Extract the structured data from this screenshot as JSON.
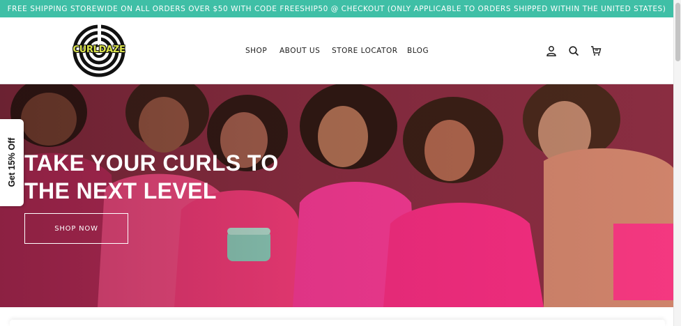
{
  "announcement": {
    "text": "FREE SHIPPING STOREWIDE ON ALL ORDERS OVER $50 WITH CODE FREESHIP50 @ CHECKOUT (ONLY APPLICABLE TO ORDERS SHIPPED WITHIN THE UNITED STATES)"
  },
  "brand": {
    "logo_text": "CURLDAZE"
  },
  "nav": {
    "shop": "SHOP",
    "about": "ABOUT US",
    "store_locator": "STORE LOCATOR",
    "blog": "BLOG"
  },
  "header_icons": [
    "account-icon",
    "search-icon",
    "cart-icon"
  ],
  "hero": {
    "headline_line1": "TAKE YOUR CURLS TO",
    "headline_line2": "THE NEXT LEVEL",
    "cta": "SHOP NOW"
  },
  "promo_tab": {
    "label": "Get 15% Off"
  },
  "colors": {
    "announcement_bg": "#3fbfa6",
    "accent_pink": "#ff3e8a",
    "logo_yellow": "#d9e24a"
  }
}
